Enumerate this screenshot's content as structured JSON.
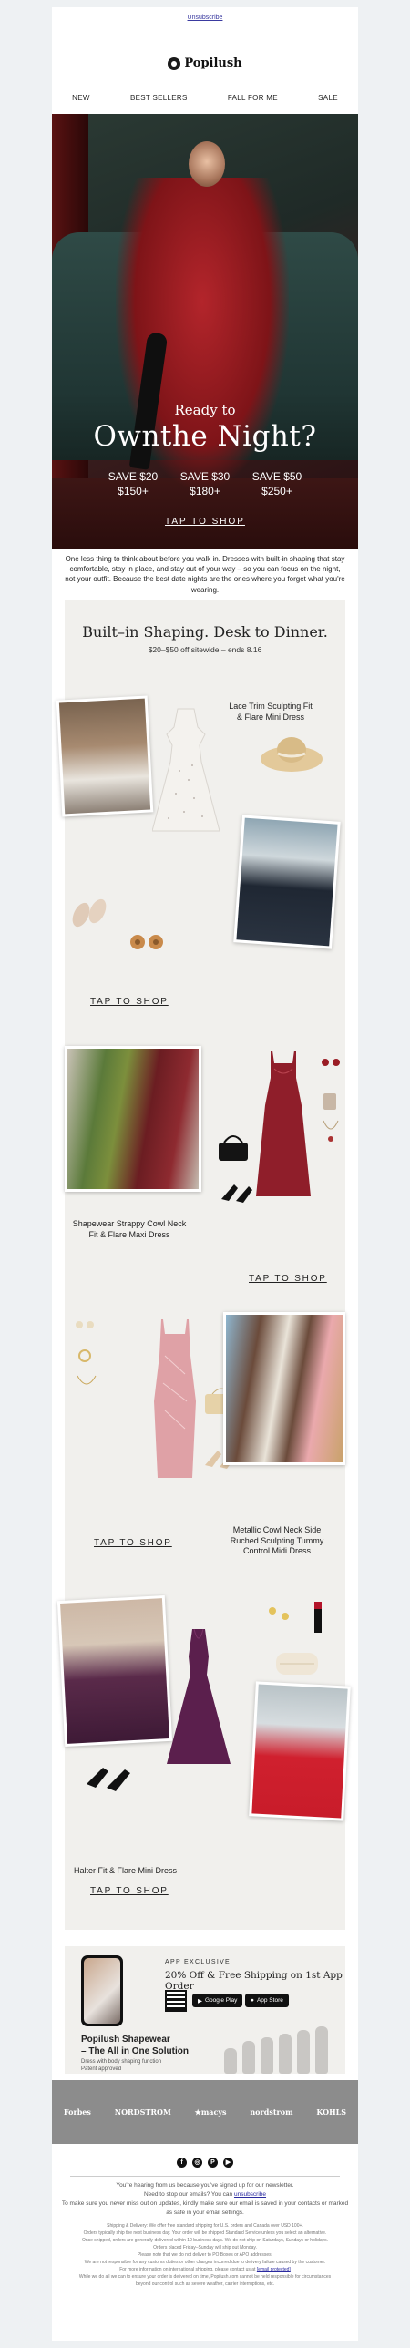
{
  "header": {
    "unsubscribe": "Unsubscribe",
    "brand": "Popilush",
    "nav": [
      "NEW",
      "BEST SELLERS",
      "FALL FOR ME",
      "SALE"
    ]
  },
  "hero": {
    "line1": "Ready to",
    "line2": "Ownthe Night?",
    "offers": [
      {
        "save": "SAVE $20",
        "threshold": "$150+"
      },
      {
        "save": "SAVE $30",
        "threshold": "$180+"
      },
      {
        "save": "SAVE $50",
        "threshold": "$250+"
      }
    ],
    "cta": "TAP TO SHOP"
  },
  "intro": "One less thing to think about before you walk in. Dresses with built-in shaping that stay comfortable, stay in place, and stay out of your way – so you can focus on the night, not your outfit. Because the best date nights are the ones where you forget what you're wearing.",
  "collection": {
    "title": "Built–in Shaping. Desk to Dinner.",
    "subtitle": "$20–$50 off sitewide – ends 8.16",
    "products": [
      {
        "name": "Lace Trim Sculpting Fit & Flare Mini Dress",
        "cta": "TAP TO SHOP"
      },
      {
        "name": "Shapewear Strappy Cowl Neck Fit & Flare Maxi Dress",
        "cta": "TAP TO SHOP"
      },
      {
        "name": "Metallic Cowl Neck Side Ruched Sculpting Tummy Control Midi Dress",
        "cta": "TAP TO SHOP"
      },
      {
        "name": "Halter Fit & Flare Mini Dress",
        "cta": "TAP TO SHOP"
      }
    ]
  },
  "app": {
    "label": "APP EXCLUSIVE",
    "headline": "20% Off & Free Shipping on 1st App Order",
    "google_play": "Google Play",
    "app_store": "App Store",
    "shapewear_title": "Popilush Shapewear",
    "shapewear_sub": "– The All in One Solution",
    "desc1": "Dress with body shaping function",
    "desc2": "Patent approved"
  },
  "press": [
    "Forbes",
    "NORDSTROM",
    "★macys",
    "nordstrom",
    "KOHLS"
  ],
  "social": [
    "f",
    "◎",
    "P",
    "▶"
  ],
  "footer": {
    "line1": "You're hearing from us because you've signed up for our newsletter.",
    "line2a": "Need to stop our emails? You can ",
    "line2link": "unsubscribe",
    "line3": "To make sure you never miss out on updates, kindly make sure our email is saved in your contacts or marked as safe in your email settings.",
    "fine": [
      "Shipping & Delivery: We offer free standard shipping for U.S. orders and Canada over USD 100+.",
      "Orders typically ship the next business day. Your order will be shipped Standard Service unless you select an alternative.",
      "Once shipped, orders are generally delivered within 10 business days. We do not ship on Saturdays, Sundays or holidays.",
      "Orders placed Friday–Sunday will ship out Monday.",
      "Please note that we do not deliver to PO Boxes or APO addresses.",
      "We are not responsible for any customs duties or other charges incurred due to delivery failure caused by the customer.",
      "For more information on international shipping, please contact us at",
      "While we do all we can to ensure your order is delivered on time, Popilush.com cannot be held responsible for circumstances",
      "beyond our control such as severe weather, carrier interruptions, etc."
    ],
    "fine_link": "[email protected]"
  }
}
